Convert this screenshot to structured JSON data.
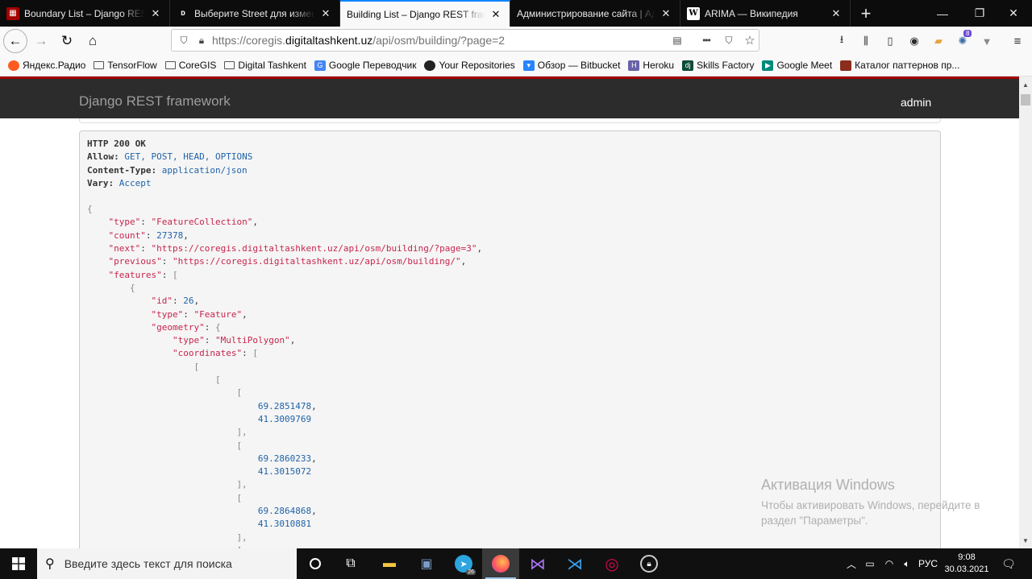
{
  "tabs": [
    {
      "title": "Boundary List – Django REST frame",
      "favicon": "drf-icon",
      "active": false
    },
    {
      "title": "Выберите Street для изменени",
      "favicon": "django-icon",
      "active": false
    },
    {
      "title": "Building List – Django REST framew",
      "favicon": "drf-icon",
      "active": true
    },
    {
      "title": "Администрирование сайта | Адм",
      "favicon": "django-icon",
      "active": false
    },
    {
      "title": "ARIMA — Википедия",
      "favicon": "wikipedia-icon",
      "active": false
    }
  ],
  "newtab_label": "+",
  "window_controls": {
    "minimize": "—",
    "maximize": "❐",
    "close": "✕"
  },
  "urlbar": {
    "prefix": "https://coregis.",
    "host": "digitaltashkent.uz",
    "path": "/api/osm/building/?page=2",
    "more_label": "•••"
  },
  "toolbar_badge": "8",
  "bookmarks": [
    {
      "label": "Яндекс.Радио",
      "icon": "yandex-radio-icon"
    },
    {
      "label": "TensorFlow",
      "icon": "folder-icon"
    },
    {
      "label": "CoreGIS",
      "icon": "folder-icon"
    },
    {
      "label": "Digital Tashkent",
      "icon": "folder-icon"
    },
    {
      "label": "Google Переводчик",
      "icon": "google-translate-icon"
    },
    {
      "label": "Your Repositories",
      "icon": "github-icon"
    },
    {
      "label": "Обзор — Bitbucket",
      "icon": "bitbucket-icon"
    },
    {
      "label": "Heroku",
      "icon": "heroku-icon"
    },
    {
      "label": "Skills Factory",
      "icon": "django-icon"
    },
    {
      "label": "Google Meet",
      "icon": "google-meet-icon"
    },
    {
      "label": "Каталог паттернов пр...",
      "icon": "refactoring-icon"
    }
  ],
  "drf": {
    "brand": "Django REST framework",
    "user": "admin"
  },
  "response": {
    "status": "HTTP 200 OK",
    "headers": [
      {
        "name": "Allow:",
        "value": "GET, POST, HEAD, OPTIONS"
      },
      {
        "name": "Content-Type:",
        "value": "application/json"
      },
      {
        "name": "Vary:",
        "value": "Accept"
      }
    ],
    "json": {
      "type": "\"FeatureCollection\"",
      "count": "27378",
      "next": "\"https://coregis.digitaltashkent.uz/api/osm/building/?page=3\"",
      "previous": "\"https://coregis.digitaltashkent.uz/api/osm/building/\"",
      "feature_id": "26",
      "feature_type": "\"Feature\"",
      "geometry_type": "\"MultiPolygon\"",
      "coords": [
        [
          "69.2851478",
          "41.3009769"
        ],
        [
          "69.2860233",
          "41.3015072"
        ],
        [
          "69.2864868",
          "41.3010881"
        ]
      ]
    }
  },
  "watermark": {
    "title": "Активация Windows",
    "text": "Чтобы активировать Windows, перейдите в раздел \"Параметры\"."
  },
  "taskbar": {
    "search_placeholder": "Введите здесь текст для поиска",
    "telegram_badge": "26",
    "lang": "РУС",
    "time": "9:08",
    "date": "30.03.2021"
  }
}
